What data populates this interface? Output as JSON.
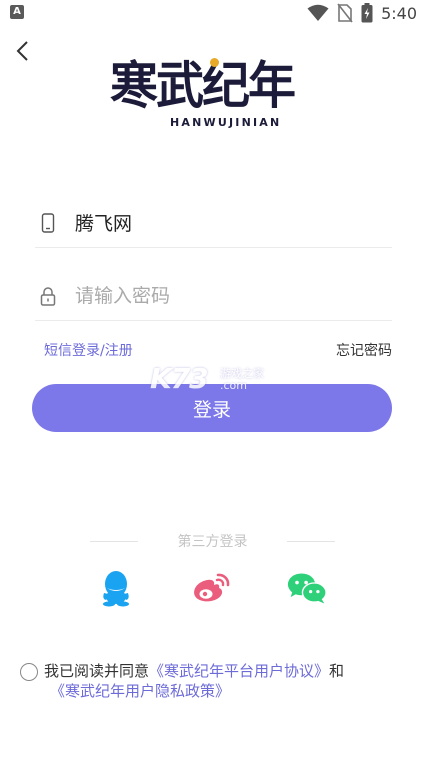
{
  "status_bar": {
    "app_icon_letter": "A",
    "time": "5:40"
  },
  "logo": {
    "title": "寒武纪年",
    "subtitle": "HANWUJINIAN"
  },
  "phone_field": {
    "value": "腾飞网",
    "placeholder": ""
  },
  "password_field": {
    "value": "",
    "placeholder": "请输入密码"
  },
  "links": {
    "sms_login": "短信登录/注册",
    "forgot_password": "忘记密码"
  },
  "login_button": {
    "label": "登录"
  },
  "watermark": {
    "brand": "K73",
    "cn": "游戏之家",
    "domain": ".com"
  },
  "third_party": {
    "title": "第三方登录",
    "providers": [
      {
        "name": "QQ",
        "icon": "qq-icon",
        "color": "#1aa3f0"
      },
      {
        "name": "Weibo",
        "icon": "weibo-icon",
        "color": "#ea5d7c"
      },
      {
        "name": "WeChat",
        "icon": "wechat-icon",
        "color": "#2ed07a"
      }
    ]
  },
  "agreement": {
    "prefix": "我已阅读并同意",
    "user_agreement": "《寒武纪年平台用户协议》",
    "conjunction": "和",
    "privacy_policy": "《寒武纪年用户隐私政策》"
  },
  "colors": {
    "accent": "#7d78ea",
    "link": "#6d6bd8"
  }
}
